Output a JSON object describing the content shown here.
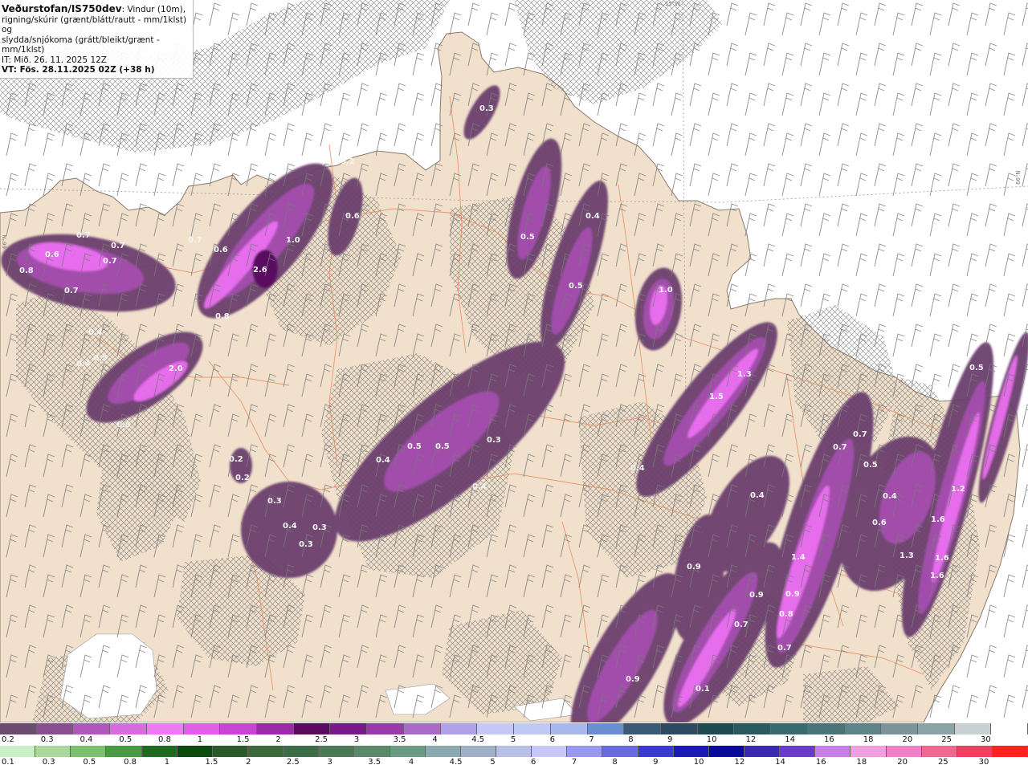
{
  "header": {
    "product": "Veðurstofan/IS750dev",
    "desc_1": ": Vindur (10m),",
    "desc_2": "rigning/skúrir (grænt/blátt/rautt - mm/1klst) og",
    "desc_3": "slydda/snjókoma (grátt/bleikt/grænt - mm/1klst)",
    "initial_time": "IT: Mið. 26. 11. 2025 12Z",
    "valid_time": "VT: Fös. 28.11.2025 02Z (+38 h)"
  },
  "grid_labels": {
    "top": "15°W",
    "right": "66°N",
    "left": "66°N"
  },
  "colors": {
    "sea": "#ffffff",
    "land": "#f0e0cc",
    "roads": "#e88a5c",
    "coastline": "#8a7a6c",
    "wind_barbs": "#7a7a7a",
    "precip_light": "#6b3f6e",
    "precip_medium": "#a64fb0",
    "precip_heavy": "#ea6ff0",
    "precip_max": "#5a1060"
  },
  "precip_labels": [
    {
      "text": "0.3"
    },
    {
      "text": "0.2"
    },
    {
      "text": "0.6"
    },
    {
      "text": "1.0"
    },
    {
      "text": "0.7"
    },
    {
      "text": "0.6"
    },
    {
      "text": "0.7"
    },
    {
      "text": "0.6"
    },
    {
      "text": "0.7"
    },
    {
      "text": "0.7"
    },
    {
      "text": "0.8"
    },
    {
      "text": "2.6"
    },
    {
      "text": "0.7"
    },
    {
      "text": "0.4"
    },
    {
      "text": "0.5"
    },
    {
      "text": "0.4"
    },
    {
      "text": "2.0"
    },
    {
      "text": "0.8"
    },
    {
      "text": "0.8"
    },
    {
      "text": "0.5"
    },
    {
      "text": "0.4"
    },
    {
      "text": "0.5"
    },
    {
      "text": "1.0"
    },
    {
      "text": "1.3"
    },
    {
      "text": "1.5"
    },
    {
      "text": "0.5"
    },
    {
      "text": "0.5"
    },
    {
      "text": "0.3"
    },
    {
      "text": "0.4"
    },
    {
      "text": "0.4"
    },
    {
      "text": "0.2"
    },
    {
      "text": "0.2"
    },
    {
      "text": "0.3"
    },
    {
      "text": "0.4"
    },
    {
      "text": "0.3"
    },
    {
      "text": "0.3"
    },
    {
      "text": "0.4"
    },
    {
      "text": "0.4"
    },
    {
      "text": "0.7"
    },
    {
      "text": "0.7"
    },
    {
      "text": "0.5"
    },
    {
      "text": "0.4"
    },
    {
      "text": "1.6"
    },
    {
      "text": "0.6"
    },
    {
      "text": "1.2"
    },
    {
      "text": "1.3"
    },
    {
      "text": "1.6"
    },
    {
      "text": "1.4"
    },
    {
      "text": "1.6"
    },
    {
      "text": "0.5"
    },
    {
      "text": "0.9"
    },
    {
      "text": "0.9"
    },
    {
      "text": "0.9"
    },
    {
      "text": "0.8"
    },
    {
      "text": "0.7"
    },
    {
      "text": "0.7"
    },
    {
      "text": "0.9"
    },
    {
      "text": "0.1"
    }
  ],
  "legend": {
    "snow": {
      "colors": [
        "#6d4a6f",
        "#8a4f91",
        "#b058ba",
        "#d66cdd",
        "#f07af5",
        "#e05ee8",
        "#c844d4",
        "#9a2aa6",
        "#5a0a5e",
        "#7a1a88",
        "#9a3aa8",
        "#aa6ac6",
        "#b0a0e8",
        "#c8c8f8",
        "#c0c8f4",
        "#a8b8ec",
        "#6a8ed0",
        "#3a5a78",
        "#2e4a60",
        "#1e4a52",
        "#2a5a60",
        "#3a6a6e",
        "#4a7478",
        "#5e8488",
        "#7a9498",
        "#8aa4a8",
        "#c8d0d4",
        "#ffffff"
      ],
      "ticks": [
        "0.2",
        "0.3",
        "0.4",
        "0.5",
        "0.8",
        "1",
        "1.5",
        "2",
        "2.5",
        "3",
        "3.5",
        "4",
        "4.5",
        "5",
        "6",
        "7",
        "8",
        "9",
        "10",
        "12",
        "14",
        "16",
        "18",
        "20",
        "25",
        "30"
      ]
    },
    "rain": {
      "colors": [
        "#c8f0c4",
        "#a8d89c",
        "#7cc070",
        "#4a9a44",
        "#1e6a1e",
        "#0a4a0a",
        "#2a5a2a",
        "#3a6a3a",
        "#3a6e46",
        "#4a7a56",
        "#5a8a6a",
        "#6a9a80",
        "#8aaab0",
        "#a0b0c8",
        "#b8c0e8",
        "#c8c8f8",
        "#9898f0",
        "#6a6ae0",
        "#3a3ad0",
        "#1a1ab8",
        "#0a0a9a",
        "#3a2ab0",
        "#6a3ac8",
        "#c880e8",
        "#f0a0e0",
        "#f080c8",
        "#f06890",
        "#f04060",
        "#ff2020"
      ],
      "ticks": [
        "0.1",
        "0.3",
        "0.5",
        "0.8",
        "1",
        "1.5",
        "2",
        "2.5",
        "3",
        "3.5",
        "4",
        "4.5",
        "5",
        "6",
        "7",
        "8",
        "9",
        "10",
        "12",
        "14",
        "16",
        "18",
        "20",
        "25",
        "30"
      ]
    }
  }
}
